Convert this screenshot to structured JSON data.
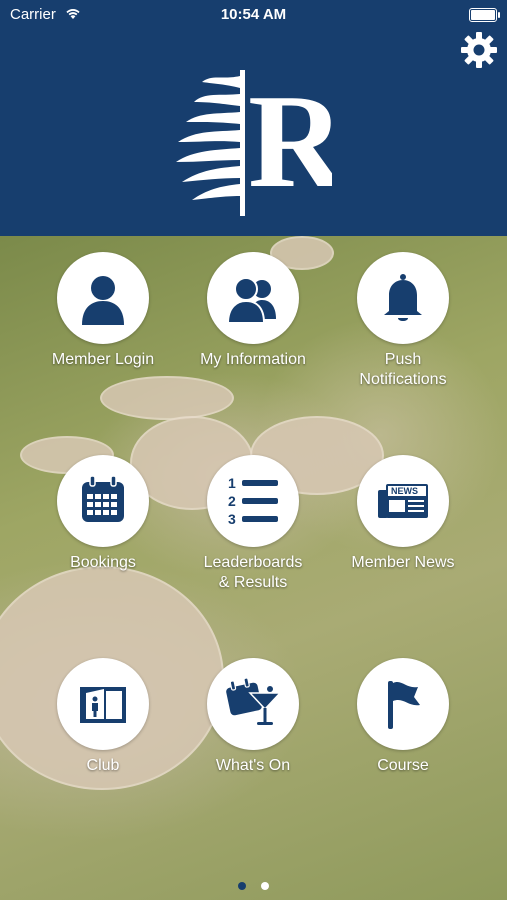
{
  "status_bar": {
    "carrier": "Carrier",
    "time": "10:54 AM"
  },
  "header": {
    "logo_letter": "R",
    "settings_icon": "gear-icon"
  },
  "colors": {
    "brand": "#173e6e",
    "tile_bg": "#ffffff"
  },
  "tiles": [
    {
      "label": "Member Login",
      "icon": "user-icon"
    },
    {
      "label": "My Information",
      "icon": "users-icon"
    },
    {
      "label": "Push Notifications",
      "icon": "bell-icon"
    },
    {
      "label": "Bookings",
      "icon": "calendar-icon"
    },
    {
      "label": "Leaderboards & Results",
      "icon": "list-icon"
    },
    {
      "label": "Member News",
      "icon": "newspaper-icon"
    },
    {
      "label": "Club",
      "icon": "clubhouse-icon"
    },
    {
      "label": "What's On",
      "icon": "cocktail-calendar-icon"
    },
    {
      "label": "Course",
      "icon": "flag-icon"
    }
  ],
  "pagination": {
    "pages": 2,
    "current": 1
  }
}
